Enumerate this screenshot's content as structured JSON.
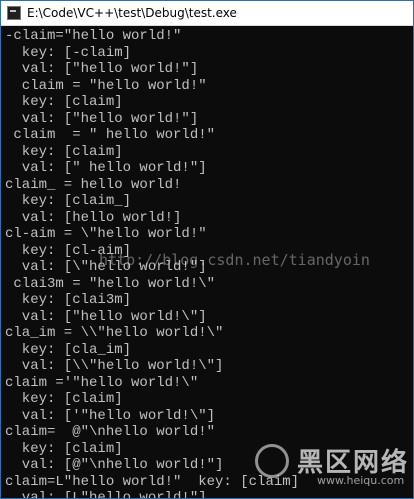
{
  "window": {
    "title": "E:\\Code\\VC++\\test\\Debug\\test.exe",
    "icon": "console-app-icon"
  },
  "console": {
    "lines": [
      "-claim=\"hello world!\"",
      "  key: [-claim]",
      "  val: [\"hello world!\"]",
      "  claim = \"hello world!\"",
      "  key: [claim]",
      "  val: [\"hello world!\"]",
      " claim  = \" hello world!\"",
      "  key: [claim]",
      "  val: [\" hello world!\"]",
      "claim_ = hello world!",
      "  key: [claim_]",
      "  val: [hello world!]",
      "cl-aim = \\\"hello world!\"",
      "  key: [cl-aim]",
      "  val: [\\\"hello world!\"]",
      " clai3m = \"hello world!\\\"",
      "  key: [clai3m]",
      "  val: [\"hello world!\\\"]",
      "cla_im = \\\\\"hello world!\\\"",
      "  key: [cla_im]",
      "  val: [\\\\\"hello world!\\\"]",
      "claim ='\"hello world!\\\"",
      "  key: [claim]",
      "  val: ['\"hello world!\\\"]",
      "claim=  @\"\\nhello world!\"",
      "  key: [claim]",
      "  val: [@\"\\nhello world!\"]",
      "claim=L\"hello world!\"  key: [claim]",
      "  val: [L\"hello world!\"]"
    ]
  },
  "watermark": {
    "text": "http://blog.csdn.net/tiandyoin"
  },
  "logo": {
    "name": "黑区网络",
    "url": "www.heiqu.com"
  }
}
